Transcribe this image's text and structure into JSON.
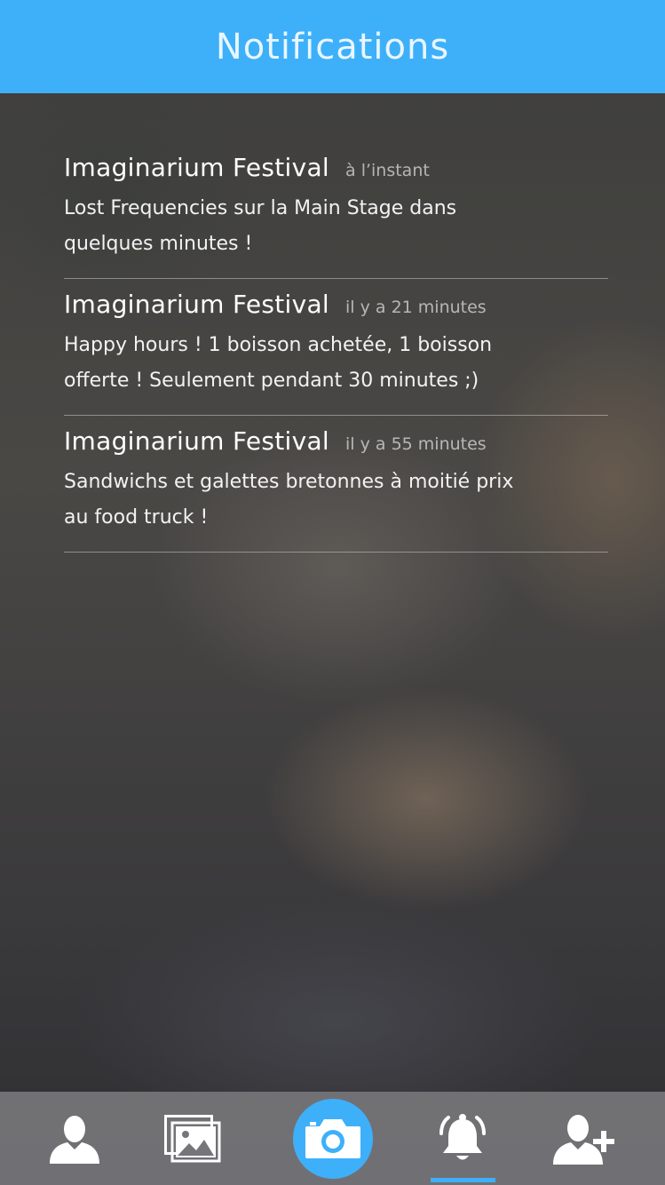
{
  "header": {
    "title": "Notifications"
  },
  "notifications": [
    {
      "title": "Imaginarium Festival",
      "time": "à l’instant",
      "line1": "Lost Frequencies sur la Main Stage dans",
      "line2": "quelques minutes !"
    },
    {
      "title": "Imaginarium Festival",
      "time": "il y a 21 minutes",
      "line1": "Happy hours ! 1 boisson achetée, 1 boisson",
      "line2": "offerte ! Seulement pendant 30 minutes ;)"
    },
    {
      "title": "Imaginarium Festival",
      "time": "il y a 55 minutes",
      "line1": "Sandwichs et galettes bretonnes à moitié prix",
      "line2": "au food truck !"
    }
  ],
  "tabbar": {
    "items": [
      {
        "icon": "profile-icon"
      },
      {
        "icon": "gallery-icon"
      },
      {
        "icon": "camera-icon"
      },
      {
        "icon": "bell-icon",
        "active": true
      },
      {
        "icon": "add-user-icon"
      }
    ]
  },
  "colors": {
    "accent": "#3eb0fa",
    "header_text": "#e9f6ff"
  }
}
